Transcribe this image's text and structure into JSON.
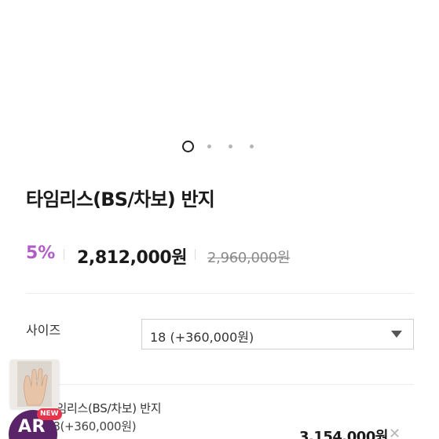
{
  "gallery": {
    "slide_count": 4,
    "active_index": 0
  },
  "product": {
    "title": "타임리스(BS/차보) 반지",
    "discount": "5%",
    "sale_price": "2,812,000원",
    "original_price": "2,960,000원"
  },
  "option": {
    "label": "사이즈",
    "selected": "18 (+360,000원)"
  },
  "selected_item": {
    "name": "타임리스(BS/차보) 반지",
    "option": "18(+360,000원)",
    "price": "3,154,000원",
    "remove_icon": "close-icon"
  },
  "ar_button": {
    "label": "AR",
    "badge": "NEW",
    "thumb_icon": "hand-ring-icon"
  },
  "colors": {
    "discount": "#b15dc8",
    "ar_badge_bg": "#5a2468",
    "new_tag": "#e8344a"
  }
}
